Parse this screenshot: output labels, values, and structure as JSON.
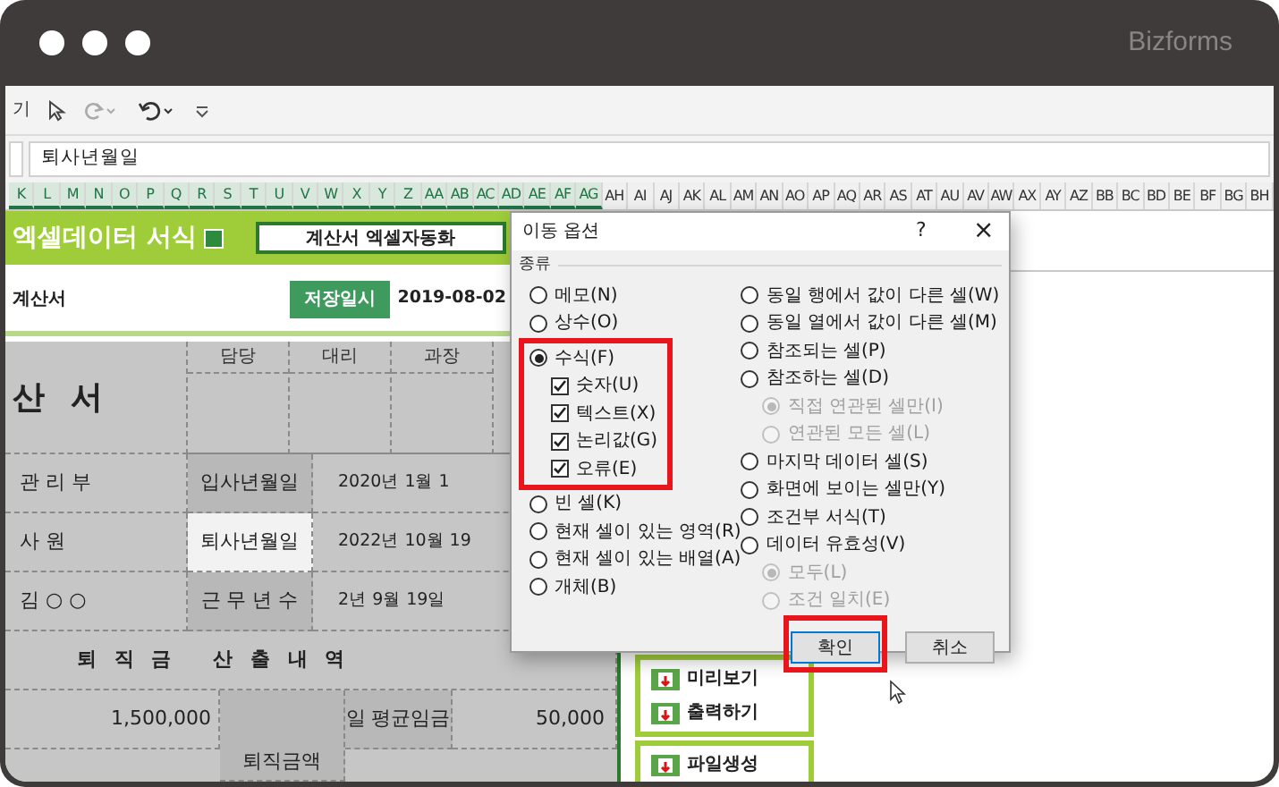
{
  "brand": "Bizforms",
  "toolbar": {
    "label": "기"
  },
  "formula_bar": {
    "value": "퇴사년월일"
  },
  "column_headers": [
    {
      "label": "K",
      "selected": true
    },
    {
      "label": "L",
      "selected": true
    },
    {
      "label": "M",
      "selected": true
    },
    {
      "label": "N",
      "selected": true
    },
    {
      "label": "O",
      "selected": true
    },
    {
      "label": "P",
      "selected": true
    },
    {
      "label": "Q",
      "selected": true
    },
    {
      "label": "R",
      "selected": true
    },
    {
      "label": "S",
      "selected": true
    },
    {
      "label": "T",
      "selected": true
    },
    {
      "label": "U",
      "selected": true
    },
    {
      "label": "V",
      "selected": true
    },
    {
      "label": "W",
      "selected": true
    },
    {
      "label": "X",
      "selected": true
    },
    {
      "label": "Y",
      "selected": true
    },
    {
      "label": "Z",
      "selected": true
    },
    {
      "label": "AA",
      "selected": true
    },
    {
      "label": "AB",
      "selected": true
    },
    {
      "label": "AC",
      "selected": true
    },
    {
      "label": "AD",
      "selected": true
    },
    {
      "label": "AE",
      "selected": true
    },
    {
      "label": "AF",
      "selected": true
    },
    {
      "label": "AG",
      "selected": true
    },
    {
      "label": "AH",
      "selected": false
    },
    {
      "label": "AI",
      "selected": false
    },
    {
      "label": "AJ",
      "selected": false
    },
    {
      "label": "AK",
      "selected": false
    },
    {
      "label": "AL",
      "selected": false
    },
    {
      "label": "AM",
      "selected": false
    },
    {
      "label": "AN",
      "selected": false
    },
    {
      "label": "AO",
      "selected": false
    },
    {
      "label": "AP",
      "selected": false
    },
    {
      "label": "AQ",
      "selected": false
    },
    {
      "label": "AR",
      "selected": false
    },
    {
      "label": "AS",
      "selected": false
    },
    {
      "label": "AT",
      "selected": false
    },
    {
      "label": "AU",
      "selected": false
    },
    {
      "label": "AV",
      "selected": false
    },
    {
      "label": "AW",
      "selected": false
    },
    {
      "label": "AX",
      "selected": false
    },
    {
      "label": "AY",
      "selected": false
    },
    {
      "label": "AZ",
      "selected": false
    },
    {
      "label": "BB",
      "selected": false
    },
    {
      "label": "BC",
      "selected": false
    },
    {
      "label": "BD",
      "selected": false
    },
    {
      "label": "BE",
      "selected": false
    },
    {
      "label": "BF",
      "selected": false
    },
    {
      "label": "BG",
      "selected": false
    },
    {
      "label": "BH",
      "selected": false
    }
  ],
  "sheet": {
    "banner_title": "엑셀데이터 서식",
    "banner_box": "계산서 엑셀자동화",
    "doc_name": "계산서",
    "save_label": "저장일시",
    "save_date": "2019-08-02",
    "doc_title": "산 서",
    "approval": [
      "담당",
      "대리",
      "과장"
    ],
    "info_rows": [
      {
        "col_1": "관 리 부",
        "label": "입사년월일",
        "value": "2020년 1월 1",
        "selected": false
      },
      {
        "col_1": "사  원",
        "label": "퇴사년월일",
        "value": "2022년 10월 19",
        "selected": true
      },
      {
        "col_1": "김 ○ ○",
        "label": "근 무 년 수",
        "value": "2년  9월  19일",
        "selected": false
      }
    ],
    "section_title": "퇴 직 금   산 출 내 역",
    "calc_row": {
      "amount": "1,500,000",
      "group": "퇴직금액",
      "label": "일 평균임금",
      "value": "50,000"
    },
    "side_menu": [
      {
        "items": [
          "미리보기",
          "출력하기"
        ]
      },
      {
        "items": [
          "파일생성"
        ]
      }
    ]
  },
  "dialog": {
    "title": "이동 옵션",
    "help": "?",
    "close": "×",
    "group": "종류",
    "left": [
      {
        "label": "메모(N)",
        "kind": "radio",
        "selected": false
      },
      {
        "label": "상수(O)",
        "kind": "radio",
        "selected": false
      },
      {
        "label": "수식(F)",
        "kind": "radio",
        "selected": true,
        "highlighted": true,
        "children": [
          {
            "label": "숫자(U)",
            "kind": "checkbox",
            "checked": true
          },
          {
            "label": "텍스트(X)",
            "kind": "checkbox",
            "checked": true
          },
          {
            "label": "논리값(G)",
            "kind": "checkbox",
            "checked": true
          },
          {
            "label": "오류(E)",
            "kind": "checkbox",
            "checked": true
          }
        ]
      },
      {
        "label": "빈 셀(K)",
        "kind": "radio",
        "selected": false
      },
      {
        "label": "현재 셀이 있는 영역(R)",
        "kind": "radio",
        "selected": false
      },
      {
        "label": "현재 셀이 있는 배열(A)",
        "kind": "radio",
        "selected": false
      },
      {
        "label": "개체(B)",
        "kind": "radio",
        "selected": false
      }
    ],
    "right": [
      {
        "label": "동일 행에서 값이 다른 셀(W)",
        "kind": "radio",
        "selected": false
      },
      {
        "label": "동일 열에서 값이 다른 셀(M)",
        "kind": "radio",
        "selected": false
      },
      {
        "label": "참조되는 셀(P)",
        "kind": "radio",
        "selected": false
      },
      {
        "label": "참조하는 셀(D)",
        "kind": "radio",
        "selected": false,
        "children": [
          {
            "label": "직접 연관된 셀만(I)",
            "kind": "radio",
            "selected": true,
            "disabled": true
          },
          {
            "label": "연관된 모든 셀(L)",
            "kind": "radio",
            "selected": false,
            "disabled": true
          }
        ]
      },
      {
        "label": "마지막 데이터 셀(S)",
        "kind": "radio",
        "selected": false
      },
      {
        "label": "화면에 보이는 셀만(Y)",
        "kind": "radio",
        "selected": false
      },
      {
        "label": "조건부 서식(T)",
        "kind": "radio",
        "selected": false
      },
      {
        "label": "데이터 유효성(V)",
        "kind": "radio",
        "selected": false,
        "children": [
          {
            "label": "모두(L)",
            "kind": "radio",
            "selected": true,
            "disabled": true
          },
          {
            "label": "조건 일치(E)",
            "kind": "radio",
            "selected": false,
            "disabled": true
          }
        ]
      }
    ],
    "buttons": [
      {
        "label": "확인",
        "highlighted": true
      },
      {
        "label": "취소",
        "highlighted": false
      }
    ]
  }
}
